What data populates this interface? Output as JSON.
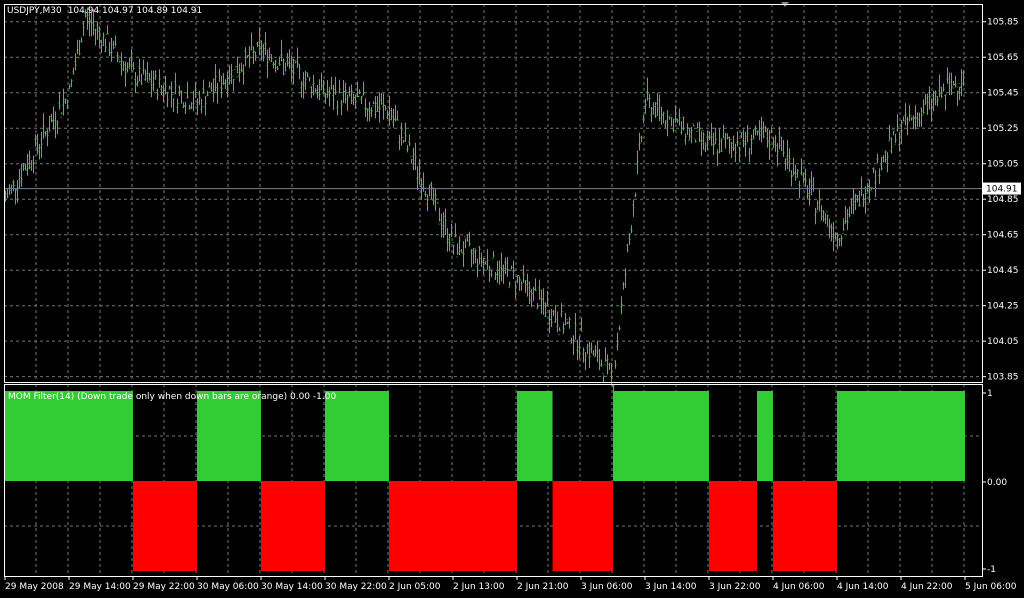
{
  "colors": {
    "background": "#000000",
    "grid": "#6c7a6c",
    "frame": "#ffffff",
    "price_bar": "#3cc83c",
    "current_line": "#708090",
    "mom_up": "#32cd32",
    "mom_down": "#ff0000",
    "text": "#ffffff"
  },
  "header": {
    "symbol_label": "USDJPY,M30",
    "ohlc_label": "104.94 104.97 104.89 104.91"
  },
  "price_panel": {
    "current_price_label": "104.91",
    "y_tick_labels": [
      "105.85",
      "105.65",
      "105.45",
      "105.25",
      "105.05",
      "104.85",
      "104.65",
      "104.45",
      "104.25",
      "104.05",
      "103.85"
    ]
  },
  "indicator_panel": {
    "title": "MOM Filter(14)  (Down trade only  when down bars are orange) 0.00 -1.00",
    "y_tick_labels": [
      "1",
      "0.00",
      "-1"
    ]
  },
  "time_axis": {
    "labels": [
      "29 May 2008",
      "29 May 14:00",
      "29 May 22:00",
      "30 May 06:00",
      "30 May 14:00",
      "30 May 22:00",
      "2 Jun 05:00",
      "2 Jun 13:00",
      "2 Jun 21:00",
      "3 Jun 06:00",
      "3 Jun 14:00",
      "3 Jun 22:00",
      "4 Jun 06:00",
      "4 Jun 14:00",
      "4 Jun 22:00",
      "5 Jun 06:00"
    ]
  },
  "chart_data": [
    {
      "type": "ohlc",
      "symbol": "USDJPY",
      "timeframe": "M30",
      "ylim": [
        103.82,
        105.95
      ],
      "key_points": [
        {
          "t": "29 May 2008",
          "price": 104.85
        },
        {
          "t": "29 May 14:00",
          "price": 105.45
        },
        {
          "t": "29 May 16:00",
          "price": 105.88
        },
        {
          "t": "29 May 22:00",
          "price": 105.55
        },
        {
          "t": "30 May 06:00",
          "price": 105.4
        },
        {
          "t": "30 May 14:00",
          "price": 105.7
        },
        {
          "t": "30 May 22:00",
          "price": 105.45
        },
        {
          "t": "2 Jun 05:00",
          "price": 105.35
        },
        {
          "t": "2 Jun 13:00",
          "price": 104.6
        },
        {
          "t": "2 Jun 21:00",
          "price": 104.4
        },
        {
          "t": "3 Jun 06:00",
          "price": 104.05
        },
        {
          "t": "3 Jun 10:00",
          "price": 103.85
        },
        {
          "t": "3 Jun 14:00",
          "price": 105.4
        },
        {
          "t": "3 Jun 22:00",
          "price": 105.15
        },
        {
          "t": "4 Jun 06:00",
          "price": 105.2
        },
        {
          "t": "4 Jun 14:00",
          "price": 104.65
        },
        {
          "t": "4 Jun 22:00",
          "price": 105.25
        },
        {
          "t": "5 Jun 06:00",
          "price": 105.55
        }
      ],
      "current_price": 104.91
    },
    {
      "type": "bar",
      "name": "MOM Filter(14)",
      "ylim": [
        -1,
        1
      ],
      "segments": [
        {
          "from": "29 May 2008",
          "to": "29 May 22:00",
          "value": 1
        },
        {
          "from": "29 May 22:00",
          "to": "30 May 06:00",
          "value": -1
        },
        {
          "from": "30 May 06:00",
          "to": "30 May 14:00",
          "value": 1
        },
        {
          "from": "30 May 14:00",
          "to": "30 May 22:00",
          "value": -1
        },
        {
          "from": "30 May 22:00",
          "to": "2 Jun 05:00",
          "value": 1
        },
        {
          "from": "2 Jun 05:00",
          "to": "2 Jun 21:00",
          "value": -1
        },
        {
          "from": "2 Jun 21:00",
          "to": "3 Jun 02:00",
          "value": 1
        },
        {
          "from": "3 Jun 02:00",
          "to": "3 Jun 10:00",
          "value": -1
        },
        {
          "from": "3 Jun 10:00",
          "to": "3 Jun 22:00",
          "value": 1
        },
        {
          "from": "3 Jun 22:00",
          "to": "4 Jun 04:00",
          "value": -1
        },
        {
          "from": "4 Jun 04:00",
          "to": "4 Jun 06:00",
          "value": 1
        },
        {
          "from": "4 Jun 06:00",
          "to": "4 Jun 14:00",
          "value": -1
        },
        {
          "from": "4 Jun 14:00",
          "to": "5 Jun 06:00",
          "value": 1
        }
      ]
    }
  ]
}
